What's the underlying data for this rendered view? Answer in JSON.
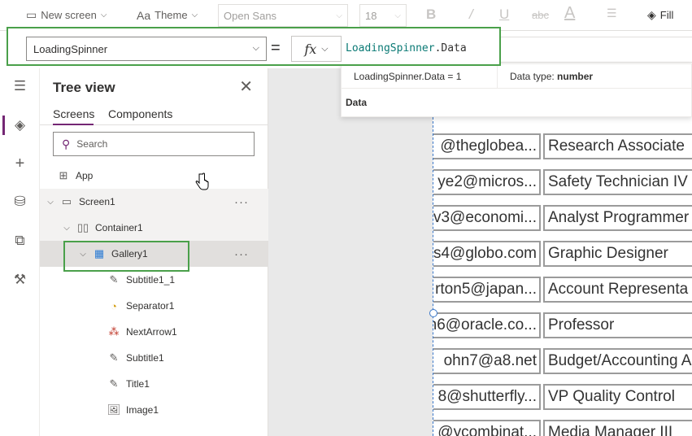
{
  "toolbar": {
    "new_screen": "New screen",
    "theme": "Theme",
    "font": "Open Sans",
    "font_size": "18",
    "fill": "Fill"
  },
  "formula_bar": {
    "property": "LoadingSpinner",
    "equals": "=",
    "fx": "fx",
    "formula_control": "LoadingSpinner",
    "formula_property": ".Data"
  },
  "tooltip": {
    "result": "LoadingSpinner.Data  =  1",
    "datatype_label": "Data type:",
    "datatype_value": "number",
    "data_label": "Data"
  },
  "tree": {
    "title": "Tree view",
    "tabs": [
      "Screens",
      "Components"
    ],
    "search_placeholder": "Search",
    "app": "App",
    "nodes": [
      {
        "label": "Screen1"
      },
      {
        "label": "Container1"
      },
      {
        "label": "Gallery1"
      },
      {
        "label": "Subtitle1_1"
      },
      {
        "label": "Separator1"
      },
      {
        "label": "NextArrow1"
      },
      {
        "label": "Subtitle1"
      },
      {
        "label": "Title1"
      },
      {
        "label": "Image1"
      }
    ]
  },
  "gallery": {
    "rows": [
      {
        "email": "@theglobea...",
        "title": "Research Associate"
      },
      {
        "email": "ye2@micros...",
        "title": "Safety Technician IV"
      },
      {
        "email": "v3@economi...",
        "title": "Analyst Programmer"
      },
      {
        "email": "s4@globo.com",
        "title": "Graphic Designer"
      },
      {
        "email": "rton5@japan...",
        "title": "Account Representa"
      },
      {
        "email": "n6@oracle.co...",
        "title": "Professor"
      },
      {
        "email": "ohn7@a8.net",
        "title": "Budget/Accounting A"
      },
      {
        "email": "8@shutterfly...",
        "title": "VP Quality Control"
      },
      {
        "email": "@ycombinat...",
        "title": "Media Manager III"
      }
    ]
  }
}
